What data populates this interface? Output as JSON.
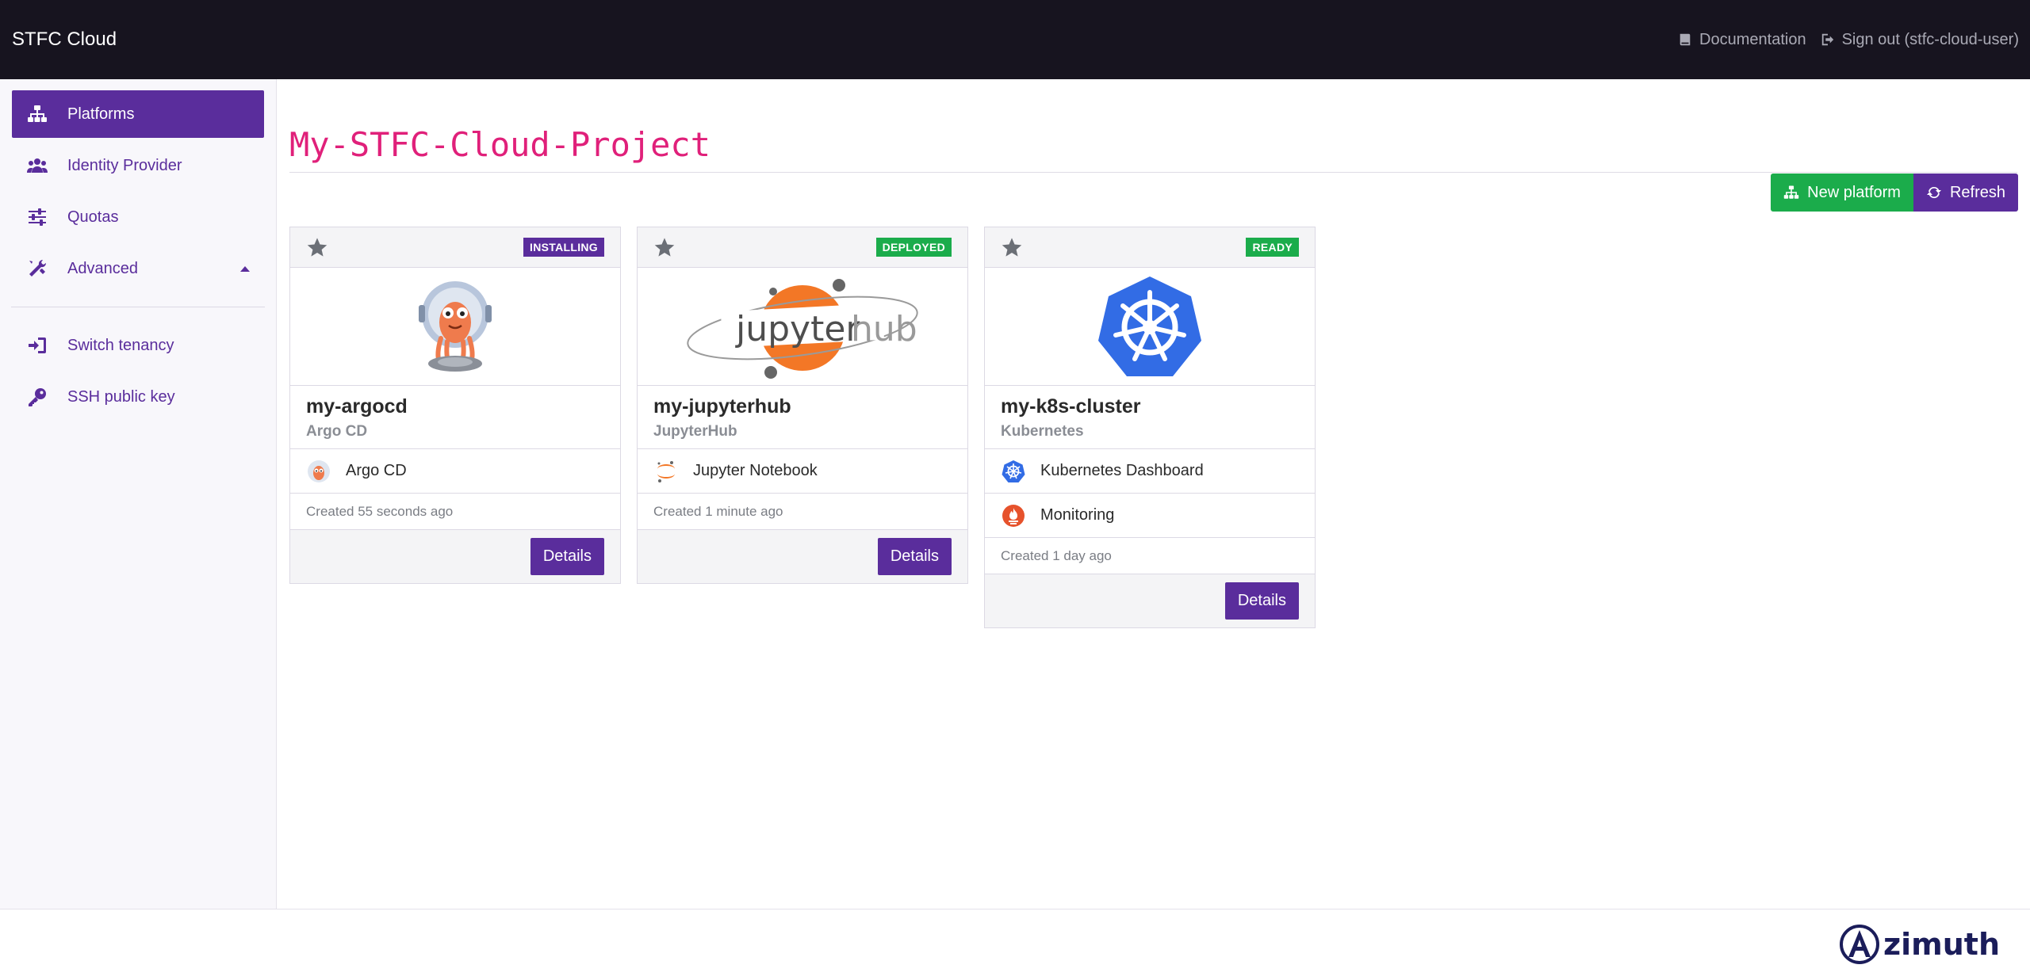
{
  "navbar": {
    "brand": "STFC Cloud",
    "documentation_label": "Documentation",
    "signout_label": "Sign out (stfc-cloud-user)"
  },
  "sidebar": {
    "items": [
      {
        "label": "Platforms",
        "icon": "sitemap-icon",
        "active": true
      },
      {
        "label": "Identity Provider",
        "icon": "users-icon"
      },
      {
        "label": "Quotas",
        "icon": "sliders-icon"
      },
      {
        "label": "Advanced",
        "icon": "tools-icon"
      }
    ],
    "secondary_items": [
      {
        "label": "Switch tenancy",
        "icon": "sign-in-icon"
      },
      {
        "label": "SSH public key",
        "icon": "key-icon"
      }
    ]
  },
  "main": {
    "title": "My-STFC-Cloud-Project",
    "new_platform_label": "New platform",
    "refresh_label": "Refresh"
  },
  "platforms": [
    {
      "name": "my-argocd",
      "type": "Argo CD",
      "status": "INSTALLING",
      "status_color": "#5a2d9c",
      "services": [
        {
          "label": "Argo CD",
          "icon": "argocd-icon"
        }
      ],
      "created": "Created 55 seconds ago",
      "details_label": "Details"
    },
    {
      "name": "my-jupyterhub",
      "type": "JupyterHub",
      "status": "DEPLOYED",
      "status_color": "#1bac4b",
      "services": [
        {
          "label": "Jupyter Notebook",
          "icon": "jupyter-icon"
        }
      ],
      "created": "Created 1 minute ago",
      "details_label": "Details"
    },
    {
      "name": "my-k8s-cluster",
      "type": "Kubernetes",
      "status": "READY",
      "status_color": "#1bac4b",
      "services": [
        {
          "label": "Kubernetes Dashboard",
          "icon": "kubernetes-icon"
        },
        {
          "label": "Monitoring",
          "icon": "prometheus-icon"
        }
      ],
      "created": "Created 1 day ago",
      "details_label": "Details"
    }
  ],
  "footer": {
    "logo_text": "zimuth"
  },
  "colors": {
    "accent": "#5a2d9c",
    "success": "#1bac4b",
    "title": "#e0207a",
    "navbar": "#17141f"
  }
}
